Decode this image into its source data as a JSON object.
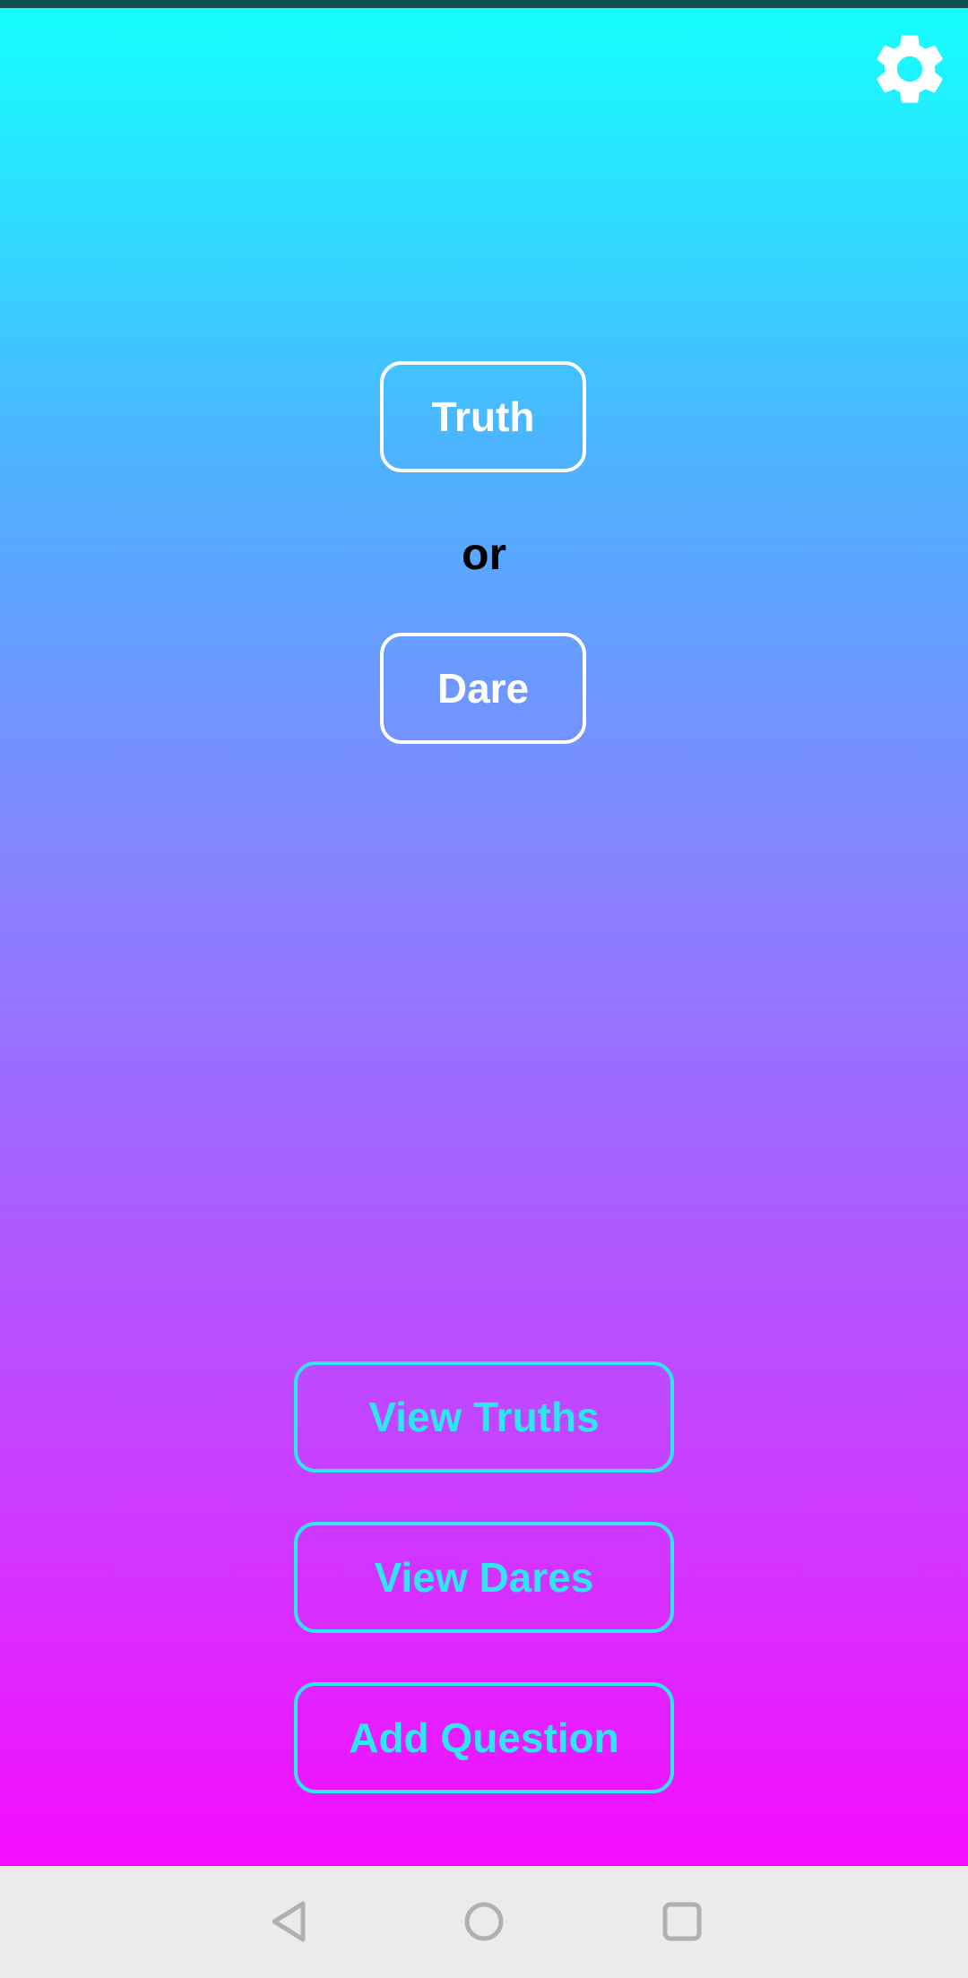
{
  "header": {
    "settings_icon": "gear-icon"
  },
  "main": {
    "truth_label": "Truth",
    "or_label": "or",
    "dare_label": "Dare"
  },
  "actions": {
    "view_truths_label": "View Truths",
    "view_dares_label": "View Dares",
    "add_question_label": "Add Question"
  },
  "navigation": {
    "back_icon": "back-triangle-icon",
    "home_icon": "home-circle-icon",
    "recents_icon": "recents-square-icon"
  },
  "colors": {
    "gradient_top": "#14ffff",
    "gradient_bottom": "#f50cff",
    "button_outline": "#ffffff",
    "action_accent": "#2ee5f0",
    "nav_background": "#ebebeb"
  }
}
